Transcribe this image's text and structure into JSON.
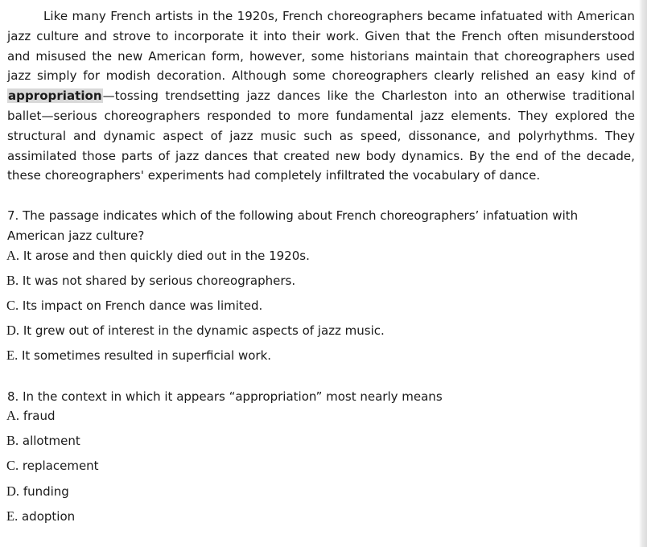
{
  "passage": {
    "before": "Like many French artists in the 1920s, French choreographers became infatuated with American jazz culture and strove to incorporate it into their work. Given that the French often misunderstood and misused the new American form, however, some historians maintain that choreographers used jazz simply for modish decoration. Although some choreographers clearly relished an easy kind of ",
    "highlight": "appropriation",
    "after": "—tossing trendsetting jazz dances like the Charleston into an otherwise traditional ballet—serious choreographers responded to more fundamental jazz elements. They explored the structural and dynamic aspect of jazz music such as speed, dissonance, and polyrhythms. They assimilated those parts of jazz dances that created new body dynamics. By the end of the decade, these choreographers' experiments had completely infiltrated the vocabulary of dance."
  },
  "questions": [
    {
      "stem": "7. The passage indicates which of the following about French choreographers’ infatuation with American jazz culture?",
      "choices": [
        {
          "letter": "A.",
          "text": " It arose and then quickly died out in the 1920s."
        },
        {
          "letter": "B.",
          "text": " It was not shared by serious choreographers."
        },
        {
          "letter": "C.",
          "text": " Its impact on French dance was limited."
        },
        {
          "letter": "D.",
          "text": " It grew out of interest in the dynamic aspects of jazz music."
        },
        {
          "letter": "E.",
          "text": " It sometimes resulted in superficial work."
        }
      ]
    },
    {
      "stem": "8. In the context in which it appears “appropriation” most nearly means",
      "choices": [
        {
          "letter": "A.",
          "text": " fraud"
        },
        {
          "letter": "B.",
          "text": " allotment"
        },
        {
          "letter": "C.",
          "text": " replacement"
        },
        {
          "letter": "D.",
          "text": " funding"
        },
        {
          "letter": "E.",
          "text": " adoption"
        }
      ]
    }
  ]
}
